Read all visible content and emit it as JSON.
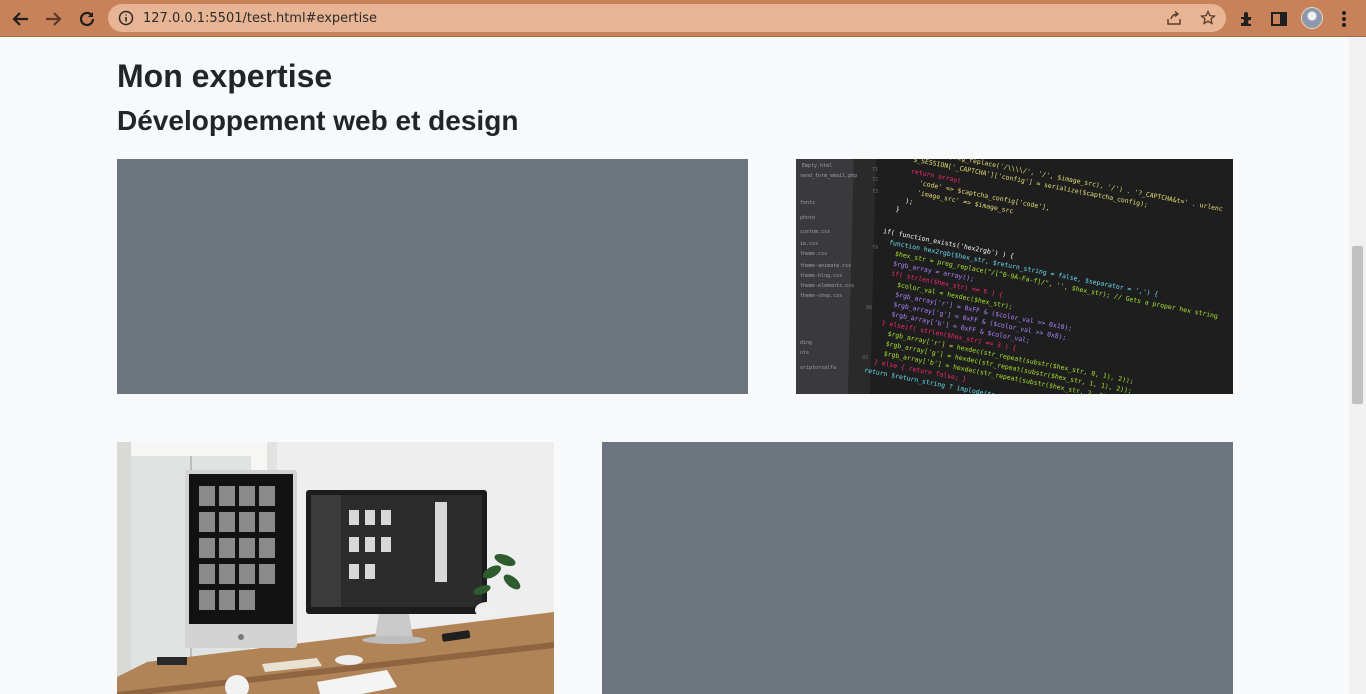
{
  "browser": {
    "url": "127.0.0.1:5501/test.html#expertise",
    "icons": {
      "back": "arrow-left-icon",
      "forward": "arrow-right-icon",
      "reload": "reload-icon",
      "site_info": "info-icon",
      "share": "share-icon",
      "bookmark": "star-icon",
      "extensions": "puzzle-icon",
      "side_panel": "sidebar-icon",
      "menu": "kebab-menu-icon"
    },
    "colors": {
      "frame": "#c7825a",
      "omnibox": "#e7b494"
    }
  },
  "section": {
    "title": "Mon expertise",
    "subtitle": "Développement web et design"
  },
  "cards": [
    {
      "kind": "placeholder",
      "color": "#6c757d"
    },
    {
      "kind": "image",
      "depicts": "code-editor-screenshot"
    },
    {
      "kind": "image",
      "depicts": "desk-with-monitors-photo"
    },
    {
      "kind": "placeholder",
      "color": "#6c757d"
    }
  ]
}
